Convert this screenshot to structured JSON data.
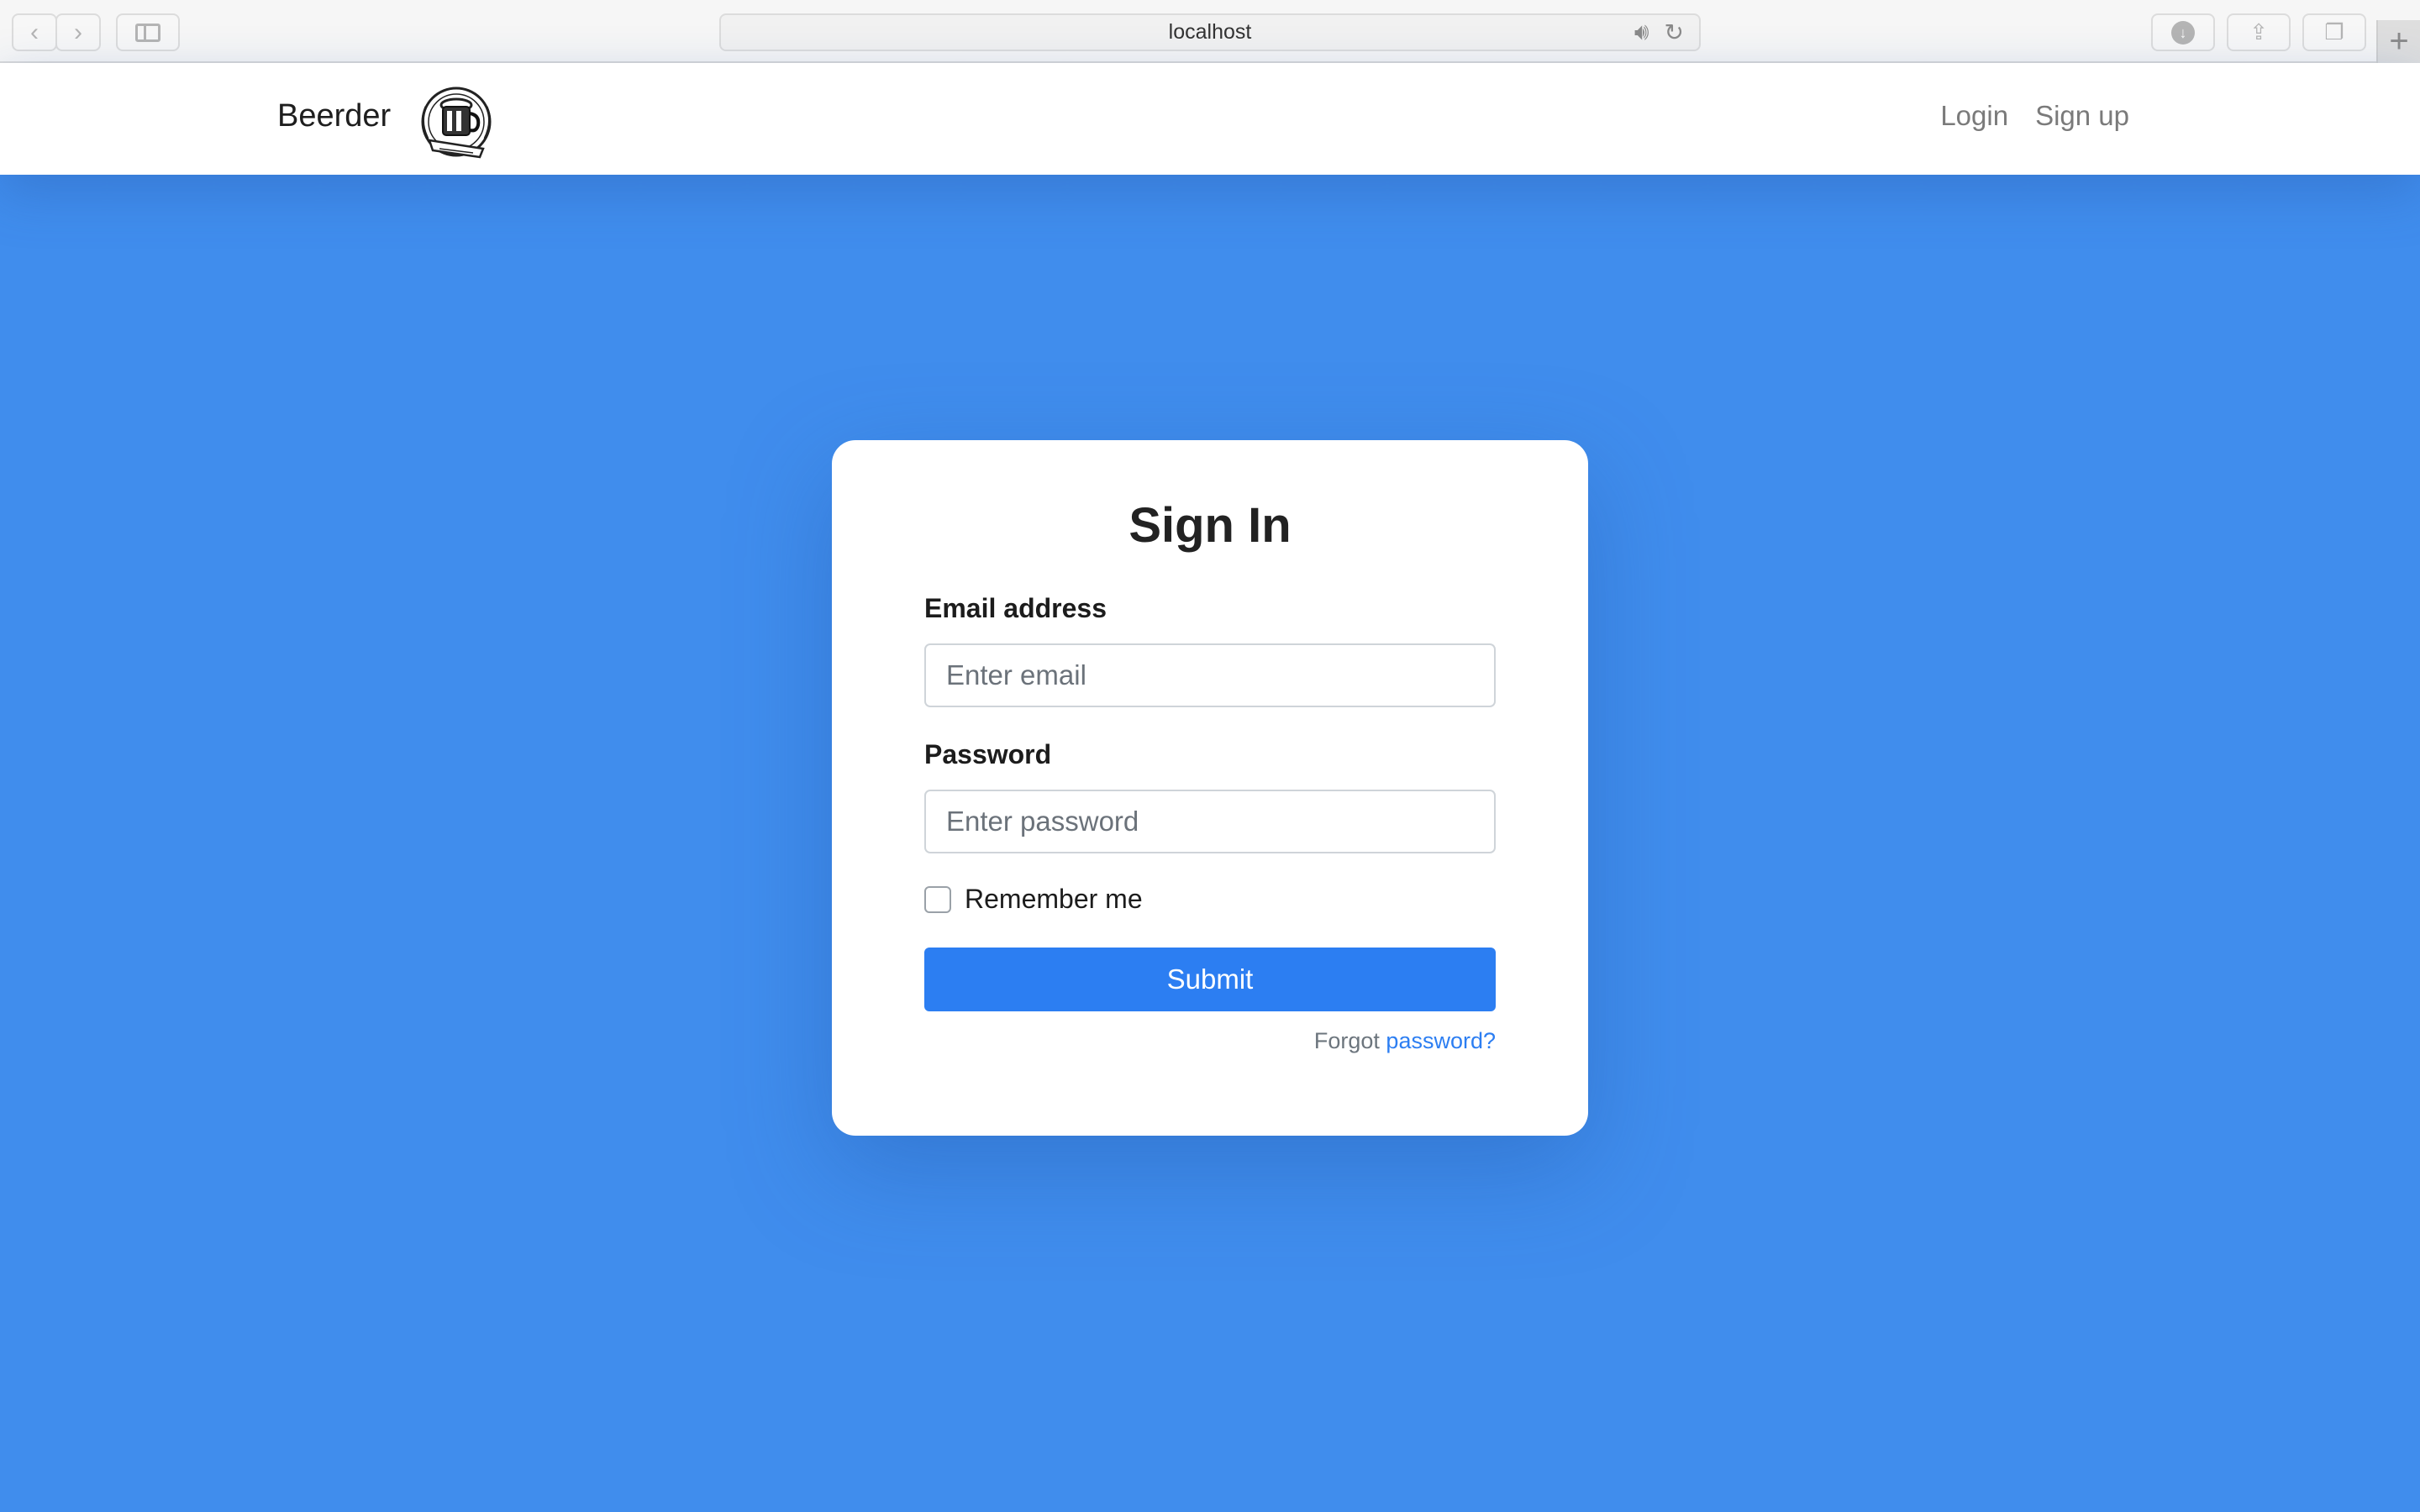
{
  "browser": {
    "url": "localhost"
  },
  "navbar": {
    "brand": "Beerder",
    "links": [
      "Login",
      "Sign up"
    ]
  },
  "card": {
    "title": "Sign In",
    "email_label": "Email address",
    "email_placeholder": "Enter email",
    "password_label": "Password",
    "password_placeholder": "Enter password",
    "remember_label": "Remember me",
    "remember_checked": false,
    "submit_label": "Submit",
    "forgot_prefix": "Forgot",
    "forgot_link": "password?"
  },
  "colors": {
    "background": "#408ded",
    "primary": "#2c7ef2",
    "card": "#ffffff"
  }
}
